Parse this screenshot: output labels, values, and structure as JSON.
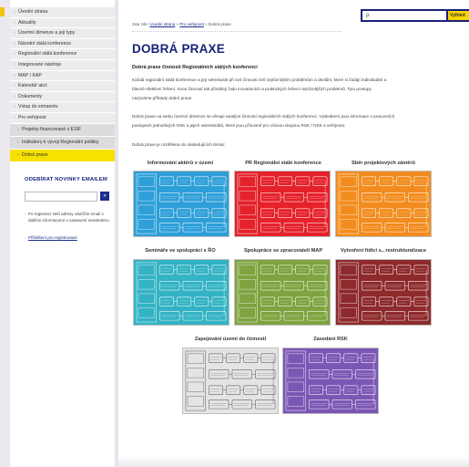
{
  "sidebar": {
    "nav": [
      "Úvodní strana",
      "Aktuality",
      "Územní dimenze a její typy",
      "Národní stálá konference",
      "Regionální stálá konference",
      "Integrované nástroje",
      "MAP / KAP",
      "Kalendář akcí",
      "Dokumenty",
      "Vstup do extranetu",
      "Pro veřejnost"
    ],
    "subnav": [
      "Projekty financované z ESIF",
      "Indikátory k vývoji Regionální politiky",
      "Dobrá praxe"
    ],
    "newsletter": {
      "title": "ODEBÍRAT NOVINKY EMAILEM",
      "go": "»",
      "note": "Po registraci Vaší adresy obdržíte email s dalšími informacemi o nastavení newsletteru",
      "link": "Přihlášení pro registrované"
    }
  },
  "search": {
    "placeholder": "ρ",
    "button": "Vyhled"
  },
  "breadcrumb": {
    "prefix": "Jste zde:",
    "items": [
      "Úvodní strana",
      "Pro veřejnost",
      "Dobrá praxe"
    ],
    "sep": "»"
  },
  "main": {
    "title": "DOBRÁ PRAXE",
    "subhead": "Dobrá praxe činnosti Regionálních stálých konferencí",
    "para1_l1": "Každá regionální stálá konference a její sekretariát při své činnosti čelí nejrůznějším problémům a úkolům, které si žádají individuální a",
    "para1_l2": "hlavně efektivní řešení. Svou činností tak přinášejí řadu inovativních a praktických řešení nejrůznějších problémů. Tyto postupy",
    "para1_l3": "nazýváme příklady dobré praxe.",
    "para2_l1": "Dobrá praxe na webu územní dimenze se věnuje analýze činností regionálních stálých konferencí. Výsledkem jsou informace o pracovních",
    "para2_l2": "postupech jednotlivých RSK a jejich sekretariátů, které jsou přínosné pro cílovou skupinu RSK / NSK a veřejnost.",
    "para3": "Dobrá praxe je rozdělena do následujících témat:"
  },
  "topics": [
    {
      "title": "Informování aktérů v území",
      "color": "#2e9fd8"
    },
    {
      "title": "PR Regionální stálé konference",
      "color": "#e5212b"
    },
    {
      "title": "Sběr projektových záměrů",
      "color": "#f28c1e"
    },
    {
      "title": "Semináře ve spolupráci s ŘO",
      "color": "#33b3c4"
    },
    {
      "title": "Spolupráce se zpracovateli MAP",
      "color": "#7ea33f"
    },
    {
      "title": "Vytvoření řídicí s., restrukturalizace",
      "color": "#8e2a2c"
    },
    {
      "title": "Zapojování území do činnosti",
      "color": "#e4e4e4"
    },
    {
      "title": "Zasedání RSK",
      "color": "#7b57b5"
    }
  ]
}
